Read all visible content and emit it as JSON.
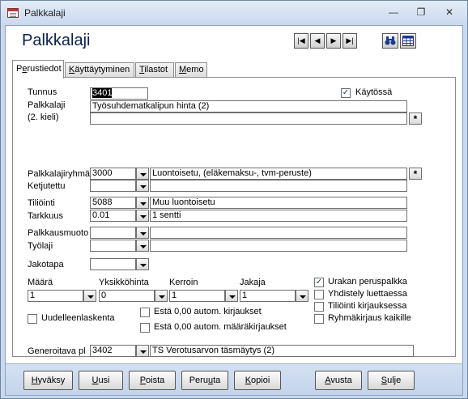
{
  "window": {
    "title": "Palkkalaji"
  },
  "form": {
    "title": "Palkkalaji"
  },
  "nav": {
    "first": "|◀",
    "prev": "◀",
    "next": "▶",
    "last": "▶|"
  },
  "tabs": [
    {
      "label": "Perustiedot",
      "key": "e"
    },
    {
      "label": "Käyttäytyminen",
      "key": "K"
    },
    {
      "label": "Tilastot",
      "key": "T"
    },
    {
      "label": "Memo",
      "key": "M"
    }
  ],
  "fields": {
    "tunnus": {
      "label": "Tunnus",
      "value": "3401"
    },
    "kaytossa": {
      "label": "Käytössä",
      "checked": true
    },
    "palkkalaji": {
      "label": "Palkkalaji",
      "value": "Työsuhdematkalipun hinta (2)"
    },
    "kieli2": {
      "label": "(2. kieli)",
      "value": ""
    },
    "palkkalajiryhma": {
      "label": "Palkkalajiryhmä",
      "code": "3000",
      "desc": "Luontoisetu, (eläkemaksu-, tvm-peruste)"
    },
    "ketjutettu": {
      "label": "Ketjutettu",
      "code": "",
      "desc": ""
    },
    "tiliointi": {
      "label": "Tiliöinti",
      "code": "5088",
      "desc": "Muu luontoisetu"
    },
    "tarkkuus": {
      "label": "Tarkkuus",
      "code": "0.01",
      "desc": "1 sentti"
    },
    "palkkausmuoto": {
      "label": "Palkkausmuoto",
      "code": "",
      "desc": ""
    },
    "tyolaji": {
      "label": "Työlaji",
      "code": "",
      "desc": ""
    },
    "jakotapa": {
      "label": "Jakotapa",
      "code": ""
    },
    "maara": {
      "label": "Määrä",
      "value": "1"
    },
    "yksikkohinta": {
      "label": "Yksikköhinta",
      "value": "0"
    },
    "kerroin": {
      "label": "Kerroin",
      "value": "1"
    },
    "jakaja": {
      "label": "Jakaja",
      "value": "1"
    },
    "uudelleenlaskenta": {
      "label": "Uudelleenlaskenta",
      "checked": false
    },
    "esta_kirjaukset": {
      "label": "Estä 0,00 autom. kirjaukset",
      "checked": false
    },
    "esta_maarakirjaukset": {
      "label": "Estä 0,00 autom. määräkirjaukset",
      "checked": false
    },
    "urakan_peruspalkka": {
      "label": "Urakan peruspalkka",
      "checked": true
    },
    "yhdistely_luettaessa": {
      "label": "Yhdistely luettaessa",
      "checked": false
    },
    "tiliointi_kirjauksessa": {
      "label": "Tiliöinti kirjauksessa",
      "checked": false
    },
    "ryhmakirjaus_kaikille": {
      "label": "Ryhmäkirjaus kaikille",
      "checked": false
    },
    "generoitava_pl": {
      "label": "Generoitava pl",
      "code": "3402",
      "desc": "TS Verotusarvon täsmäytys (2)"
    }
  },
  "buttons": {
    "hyvaksy": "Hyväksy",
    "uusi": "Uusi",
    "poista": "Poista",
    "peruuta": "Peruuta",
    "kopioi": "Kopioi",
    "avusta": "Avusta",
    "sulje": "Sulje"
  },
  "checkmark": "✓",
  "star": "*"
}
